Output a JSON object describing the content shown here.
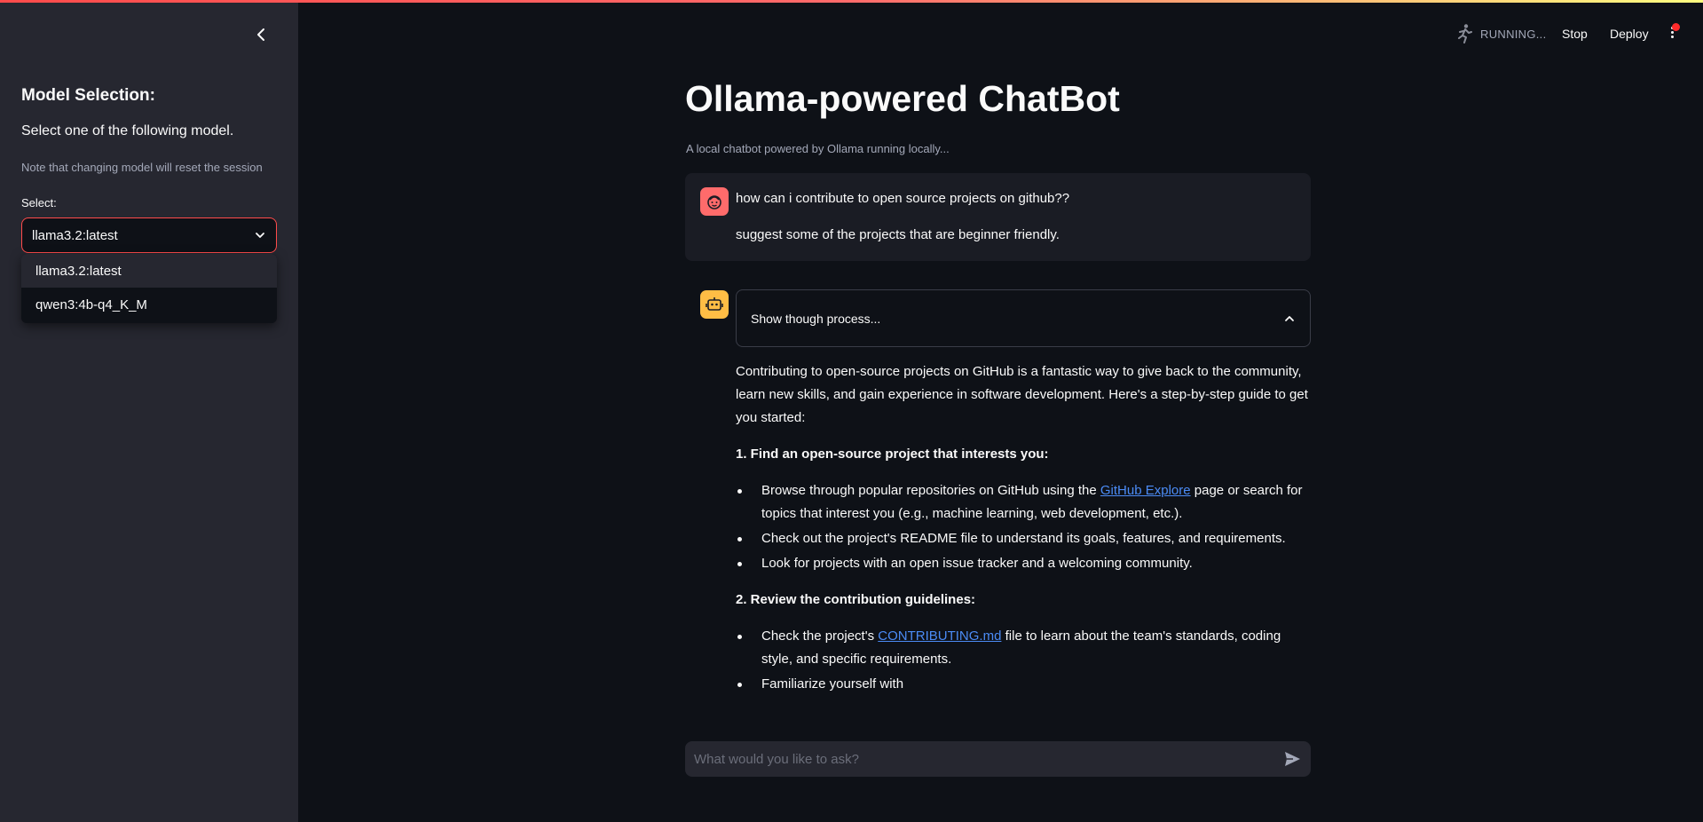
{
  "sidebar": {
    "collapse_icon": "chevron-left-icon",
    "title": "Model Selection:",
    "subtitle": "Select one of the following model.",
    "note": "Note that changing model will reset the session",
    "select_label": "Select:",
    "selected_model": "llama3.2:latest",
    "options": [
      "llama3.2:latest",
      "qwen3:4b-q4_K_M"
    ]
  },
  "header": {
    "status": "RUNNING...",
    "stop_label": "Stop",
    "deploy_label": "Deploy",
    "menu_icon": "kebab-menu-icon"
  },
  "main": {
    "title": "Ollama-powered ChatBot",
    "caption": "A local chatbot powered by Ollama running locally...",
    "user_message": {
      "line1": "how can i contribute to open source projects on github??",
      "line2": "suggest some of the projects that are beginner friendly."
    },
    "expander_label": "Show though process...",
    "answer": {
      "intro": "Contributing to open-source projects on GitHub is a fantastic way to give back to the community, learn new skills, and gain experience in software development. Here's a step-by-step guide to get you started:",
      "step1_heading": "1. Find an open-source project that interests you:",
      "step1_b1_pre": "Browse through popular repositories on GitHub using the ",
      "step1_b1_link": "GitHub Explore",
      "step1_b1_post": " page or search for topics that interest you (e.g., machine learning, web development, etc.).",
      "step1_b2": "Check out the project's README file to understand its goals, features, and requirements.",
      "step1_b3": "Look for projects with an open issue tracker and a welcoming community.",
      "step2_heading": "2. Review the contribution guidelines:",
      "step2_b1_pre": "Check the project's ",
      "step2_b1_link": "CONTRIBUTING.md",
      "step2_b1_post": " file to learn about the team's standards, coding style, and specific requirements.",
      "step2_b2": "Familiarize yourself with"
    },
    "input_placeholder": "What would you like to ask?"
  },
  "colors": {
    "accent": "#ff4b4b",
    "background": "#0e1117",
    "sidebar": "#262730",
    "link": "#4b8bf5",
    "bot_avatar": "#ffbd45",
    "user_avatar": "#ff6b6b"
  }
}
